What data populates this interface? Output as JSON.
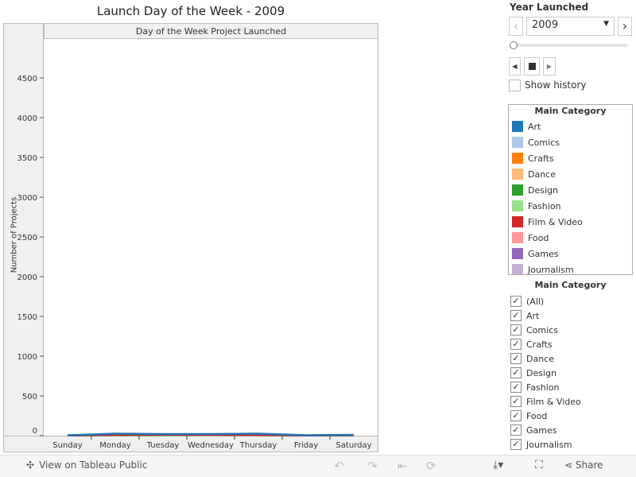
{
  "chart_data": {
    "type": "line",
    "title": "Launch Day of the Week - 2009",
    "column_header": "Day of the Week Project Launched",
    "ylabel": "Number of Projects",
    "xlabel": "",
    "ylim": [
      0,
      4900
    ],
    "yticks": [
      0,
      500,
      1000,
      1500,
      2000,
      2500,
      3000,
      3500,
      4000,
      4500
    ],
    "categories": [
      "Sunday",
      "Monday",
      "Tuesday",
      "Wednesday",
      "Thursday",
      "Friday",
      "Saturday"
    ],
    "series": [
      {
        "name": "Art",
        "color": "#1f77b4",
        "values": [
          5,
          25,
          20,
          20,
          25,
          5,
          10
        ]
      },
      {
        "name": "Film & Video",
        "color": "#d62728",
        "values": [
          3,
          10,
          12,
          10,
          8,
          3,
          5
        ]
      },
      {
        "name": "Design",
        "color": "#2ca02c",
        "values": [
          2,
          6,
          8,
          12,
          6,
          2,
          4
        ]
      }
    ],
    "grid": false
  },
  "filters": {
    "year_title": "Year Launched",
    "year_value": "2009",
    "show_history": "Show history",
    "legend_title": "Main Category",
    "legend": [
      {
        "label": "Art",
        "color": "#1f77b4"
      },
      {
        "label": "Comics",
        "color": "#aec7e8"
      },
      {
        "label": "Crafts",
        "color": "#ff7f0e"
      },
      {
        "label": "Dance",
        "color": "#ffbb78"
      },
      {
        "label": "Design",
        "color": "#2ca02c"
      },
      {
        "label": "Fashion",
        "color": "#98df8a"
      },
      {
        "label": "Film & Video",
        "color": "#d62728"
      },
      {
        "label": "Food",
        "color": "#ff9896"
      },
      {
        "label": "Games",
        "color": "#9467bd"
      },
      {
        "label": "Journalism",
        "color": "#c5b0d5"
      }
    ],
    "filter_title": "Main Category",
    "filter_items": [
      "(All)",
      "Art",
      "Comics",
      "Crafts",
      "Dance",
      "Design",
      "Fashion",
      "Film & Video",
      "Food",
      "Games",
      "Journalism"
    ]
  },
  "footer": {
    "view_label": "View on Tableau Public",
    "share_label": "Share"
  }
}
